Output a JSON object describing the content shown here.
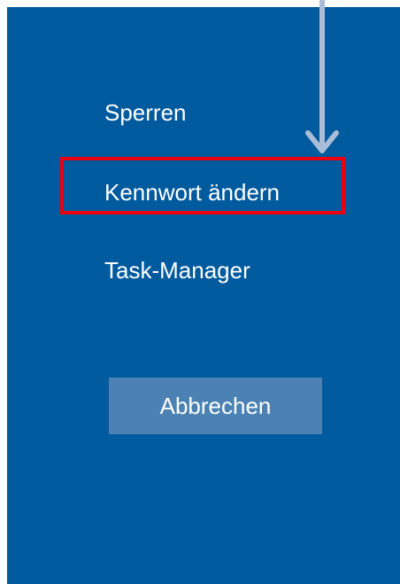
{
  "security_options": {
    "items": [
      {
        "label": "Sperren"
      },
      {
        "label": "Kennwort ändern"
      },
      {
        "label": "Task-Manager"
      }
    ],
    "cancel_label": "Abbrechen"
  },
  "colors": {
    "screen_background": "#005a9e",
    "cancel_button_background": "#4b82b3",
    "highlight_border": "#e8000f",
    "arrow": "#a9bdd8",
    "text": "#ffffff"
  },
  "annotation": {
    "highlighted_item": "Kennwort ändern",
    "arrow_icon": "down-arrow-icon"
  }
}
